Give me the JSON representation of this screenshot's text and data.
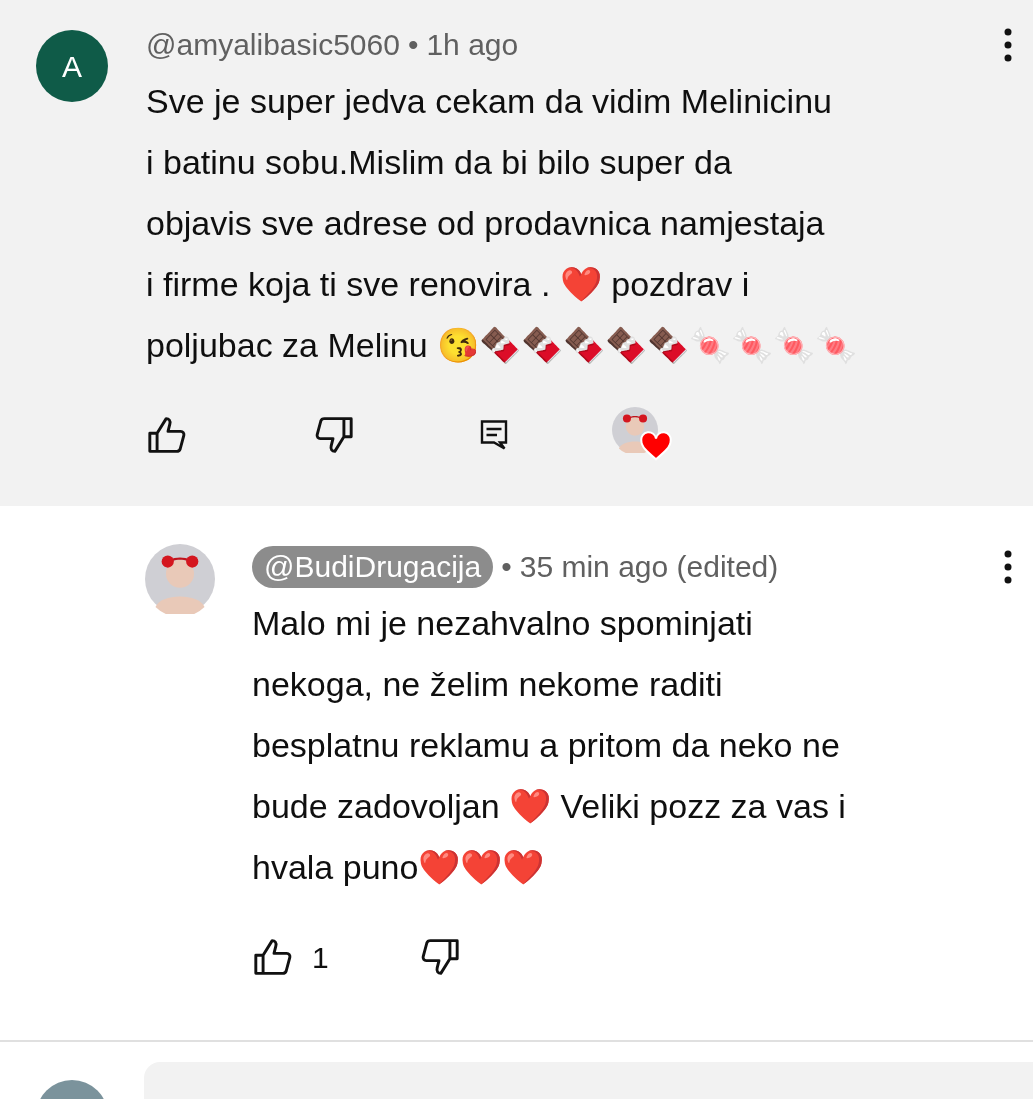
{
  "comments": [
    {
      "kind": "viewer",
      "avatar_letter": "A",
      "author": "@amyalibasic5060",
      "separator": "•",
      "time": "1h ago",
      "lines": [
        "Sve je super jedva cekam da vidim Melinicinu",
        "i batinu sobu.Mislim da bi bilo super da",
        "objavis sve adrese od prodavnica namjestaja",
        "i firme koja ti sve renovira . ❤️ pozdrav i",
        "poljubac za Melinu 😘🍫🍫🍫🍫🍫🍬🍬🍬🍬"
      ],
      "creator_hearted": true,
      "has_reply_button": true
    },
    {
      "kind": "creator",
      "author": "@BudiDrugacija",
      "separator": "•",
      "time": "35 min ago (edited)",
      "lines": [
        "Malo mi je nezahvalno spominjati",
        "nekoga, ne želim nekome raditi",
        "besplatnu reklamu a pritom da neko ne",
        "bude zadovoljan ❤️ Veliki pozz za vas i",
        "hvala puno❤️❤️❤️"
      ],
      "likes": "1",
      "creator_hearted": false,
      "has_reply_button": false
    }
  ]
}
